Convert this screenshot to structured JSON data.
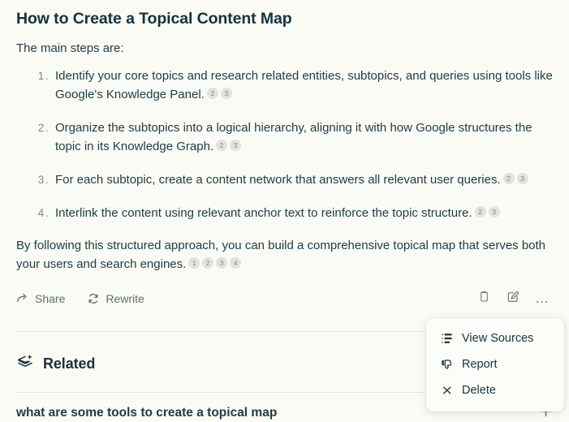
{
  "answer": {
    "title": "How to Create a Topical Content Map",
    "intro": "The main steps are:",
    "steps": [
      {
        "number": "1.",
        "text": "Identify your core topics and research related entities, subtopics, and queries using tools like Google's Knowledge Panel.",
        "citations": [
          "2",
          "3"
        ]
      },
      {
        "number": "2.",
        "text": "Organize the subtopics into a logical hierarchy, aligning it with how Google structures the topic in its Knowledge Graph.",
        "citations": [
          "2",
          "3"
        ]
      },
      {
        "number": "3.",
        "text": "For each subtopic, create a content network that answers all relevant user queries.",
        "citations": [
          "2",
          "3"
        ]
      },
      {
        "number": "4.",
        "text": "Interlink the content using relevant anchor text to reinforce the topic structure.",
        "citations": [
          "2",
          "3"
        ]
      }
    ],
    "conclusion": {
      "text": "By following this structured approach, you can build a comprehensive topical map that serves both your users and search engines.",
      "citations": [
        "1",
        "2",
        "3",
        "4"
      ]
    }
  },
  "action_bar": {
    "share_label": "Share",
    "rewrite_label": "Rewrite",
    "icons": {
      "copy": "clipboard-icon",
      "edit": "edit-pencil-icon",
      "more": "ellipsis-icon"
    }
  },
  "context_menu": {
    "items": [
      {
        "label": "View Sources",
        "icon": "sources-list-icon"
      },
      {
        "label": "Report",
        "icon": "thumbs-down-icon"
      },
      {
        "label": "Delete",
        "icon": "close-x-icon"
      }
    ]
  },
  "related": {
    "heading": "Related",
    "heading_icon": "layers-plus-icon",
    "items": [
      {
        "question": "what are some tools to create a topical map",
        "action_icon": "plus-icon"
      }
    ]
  },
  "colors": {
    "background": "#FBFBF6",
    "text": "#1C3C44",
    "heading": "#14333B",
    "muted": "#6B7878",
    "accent": "#4B8C99",
    "chip_bg": "#E3E3DE",
    "divider": "#E6E6DF"
  }
}
